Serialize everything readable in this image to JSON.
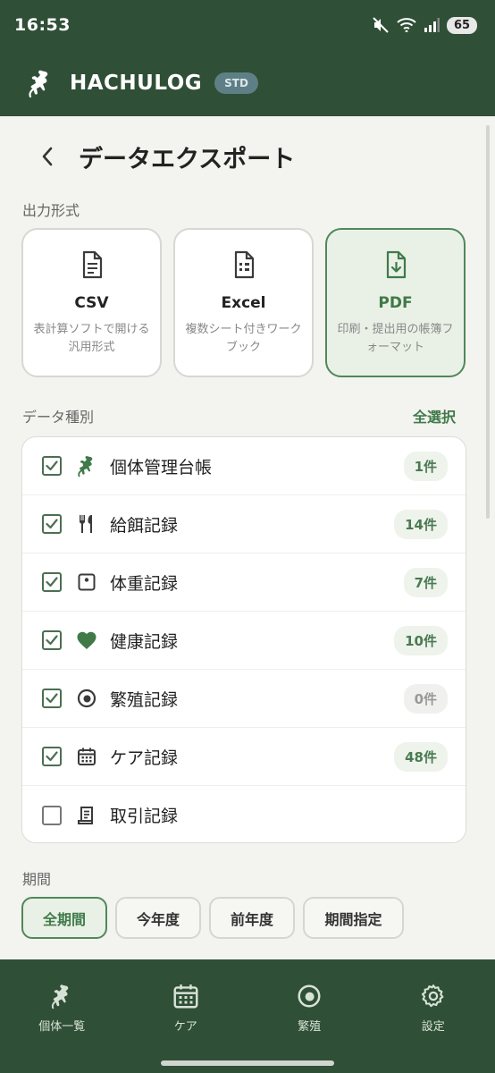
{
  "status_bar": {
    "time": "16:53",
    "battery": "65"
  },
  "app": {
    "title": "HACHULOG",
    "plan_badge": "STD"
  },
  "page": {
    "title": "データエクスポート"
  },
  "output_format": {
    "label": "出力形式",
    "options": [
      {
        "name": "CSV",
        "description": "表計算ソフトで開ける汎用形式",
        "selected": false
      },
      {
        "name": "Excel",
        "description": "複数シート付きワークブック",
        "selected": false
      },
      {
        "name": "PDF",
        "description": "印刷・提出用の帳簿フォーマット",
        "selected": true
      }
    ]
  },
  "data_types": {
    "label": "データ種別",
    "select_all": "全選択",
    "items": [
      {
        "label": "個体管理台帳",
        "count": "1件",
        "checked": true,
        "icon": "gecko-icon"
      },
      {
        "label": "給餌記録",
        "count": "14件",
        "checked": true,
        "icon": "utensils-icon"
      },
      {
        "label": "体重記録",
        "count": "7件",
        "checked": true,
        "icon": "scale-icon"
      },
      {
        "label": "健康記録",
        "count": "10件",
        "checked": true,
        "icon": "heart-icon"
      },
      {
        "label": "繁殖記録",
        "count": "0件",
        "checked": true,
        "icon": "egg-icon"
      },
      {
        "label": "ケア記録",
        "count": "48件",
        "checked": true,
        "icon": "calendar-icon"
      },
      {
        "label": "取引記録",
        "count": "",
        "checked": false,
        "icon": "receipt-icon"
      }
    ]
  },
  "period": {
    "label": "期間",
    "options": [
      {
        "label": "全期間",
        "selected": true
      },
      {
        "label": "今年度",
        "selected": false
      },
      {
        "label": "前年度",
        "selected": false
      },
      {
        "label": "期間指定",
        "selected": false
      }
    ]
  },
  "bottom_nav": [
    {
      "label": "個体一覧",
      "icon": "gecko-icon"
    },
    {
      "label": "ケア",
      "icon": "calendar-icon"
    },
    {
      "label": "繁殖",
      "icon": "egg-icon"
    },
    {
      "label": "設定",
      "icon": "gear-icon"
    }
  ],
  "colors": {
    "primary_dark": "#2f4f36",
    "accent_green": "#3f7a48",
    "selected_bg": "#e9f1e7"
  }
}
